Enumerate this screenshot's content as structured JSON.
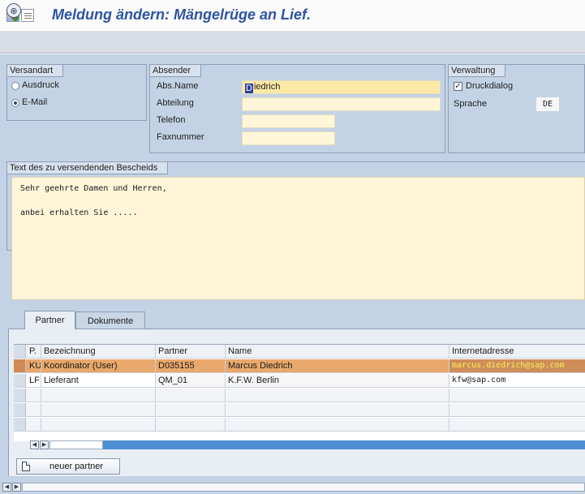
{
  "title": "Meldung ändern: Mängelrüge an Lief.",
  "toolbar": {
    "execute_icon": "execute-icon"
  },
  "versandart": {
    "title": "Versandart",
    "options": [
      {
        "label": "Ausdruck",
        "selected": false
      },
      {
        "label": "E-Mail",
        "selected": true
      }
    ]
  },
  "absender": {
    "title": "Absender",
    "fields": [
      {
        "label": "Abs.Name",
        "value": "Diedrich"
      },
      {
        "label": "Abteilung",
        "value": ""
      },
      {
        "label": "Telefon",
        "value": ""
      },
      {
        "label": "Faxnummer",
        "value": ""
      }
    ]
  },
  "verwaltung": {
    "title": "Verwaltung",
    "druckdialog": {
      "label": "Druckdialog",
      "checked": true
    },
    "sprache": {
      "label": "Sprache",
      "value": "DE"
    }
  },
  "text": {
    "title": "Text des zu versendenden Bescheids",
    "lines": [
      "Sehr geehrte Damen und Herren,",
      "anbei erhalten Sie ....."
    ]
  },
  "tabs": [
    {
      "label": "Partner",
      "active": true
    },
    {
      "label": "Dokumente",
      "active": false
    }
  ],
  "table": {
    "columns": [
      "P.",
      "Bezeichnung",
      "Partner",
      "Name",
      "Internetadresse"
    ],
    "rows": [
      {
        "p": "KU",
        "bezeichnung": "Koordinator (User)",
        "partner": "D035155",
        "name": "Marcus Diedrich",
        "email": "marcus.diedrich@sap.com",
        "selected": true
      },
      {
        "p": "LF",
        "bezeichnung": "Lieferant",
        "partner": "QM_01",
        "name": "K.F.W. Berlin",
        "email": "kfw@sap.com",
        "selected": false
      }
    ],
    "empty_rows": 4
  },
  "buttons": {
    "new_partner": "neuer partner"
  },
  "colors": {
    "title": "#2d54a2",
    "workspace": "#c3d3e5",
    "field": "#fff6d9",
    "selected_row": "#e9a86b"
  }
}
